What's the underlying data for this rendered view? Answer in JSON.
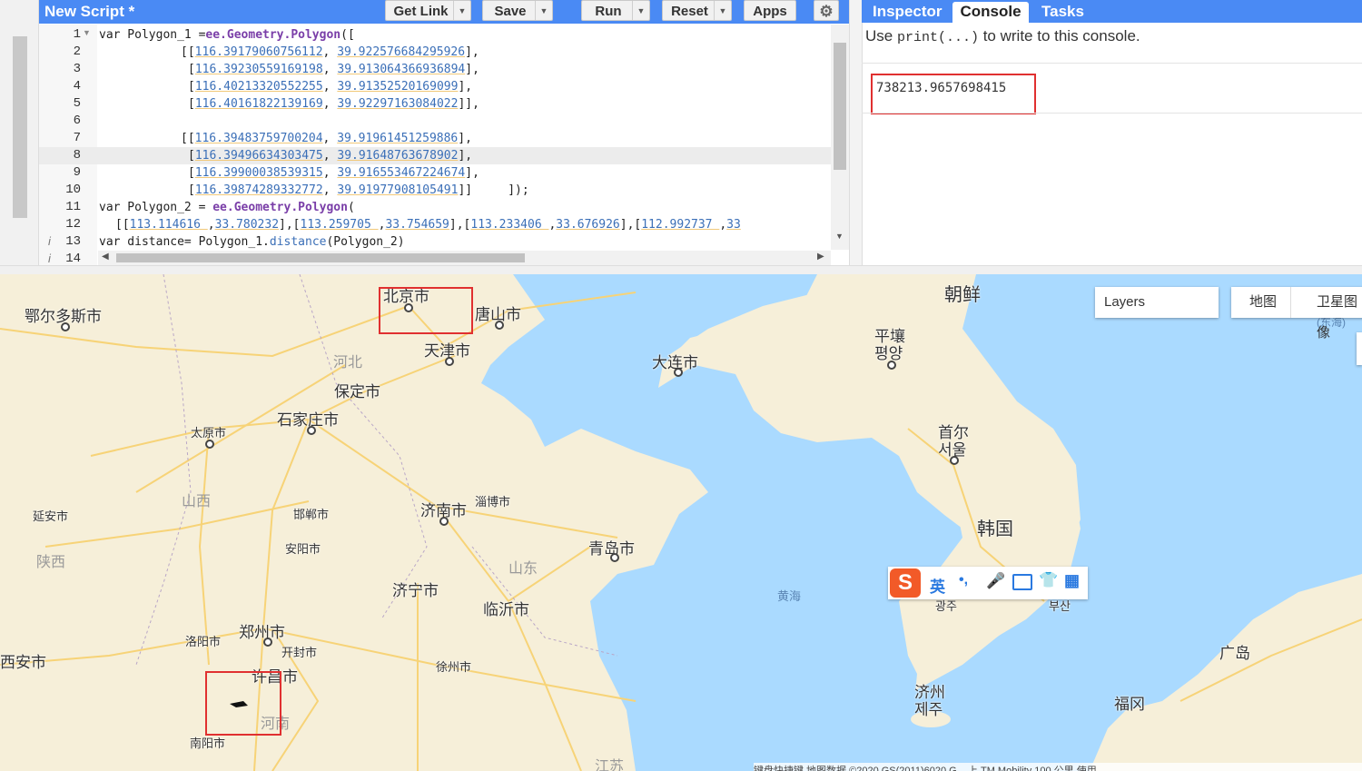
{
  "editor": {
    "title": "New Script *",
    "buttons": {
      "get_link": "Get Link",
      "save": "Save",
      "run": "Run",
      "reset": "Reset",
      "apps": "Apps"
    },
    "line_numbers": [
      "1",
      "2",
      "3",
      "4",
      "5",
      "6",
      "7",
      "8",
      "9",
      "10",
      "11",
      "12",
      "13",
      "14"
    ],
    "code": {
      "l1_kw": "var",
      "l1_a": " Polygon_1 =",
      "l1_ee": "ee.Geometry.Polygon",
      "l1_b": "([",
      "l2_a": "[[",
      "l2_n1": "116.39179060756112",
      "l2_c": ", ",
      "l2_n2": "39.922576684295926",
      "l2_e": "],",
      "l3_a": "[",
      "l3_n1": "116.39230559169198",
      "l3_n2": "39.913064366936894",
      "l3_e": "],",
      "l4_a": "[",
      "l4_n1": "116.40213320552255",
      "l4_n2": "39.91352520169099",
      "l4_e": "],",
      "l5_a": "[",
      "l5_n1": "116.40161822139169",
      "l5_n2": "39.92297163084022",
      "l5_e": "]],",
      "l7_a": "[[",
      "l7_n1": "116.39483759700204",
      "l7_n2": "39.91961451259886",
      "l7_e": "],",
      "l8_a": "[",
      "l8_n1": "116.39496634303475",
      "l8_n2": "39.91648763678902",
      "l8_e": "],",
      "l9_a": "[",
      "l9_n1": "116.39900038539315",
      "l9_n2": "39.916553467224674",
      "l9_e": "],",
      "l10_a": "[",
      "l10_n1": "116.39874289332772",
      "l10_n2": "39.91977908105491",
      "l10_e": "]]     ]);",
      "l11_kw": "var",
      "l11_a": " Polygon_2 = ",
      "l11_ee": "ee.Geometry.Polygon",
      "l11_b": "(",
      "l12_a": "[[",
      "l12_n1": "113.114616 ",
      "l12_c1": ",",
      "l12_n2": "33.780232",
      "l12_c2": "],[",
      "l12_n3": "113.259705 ",
      "l12_c3": ",",
      "l12_n4": "33.754659",
      "l12_c4": "],[",
      "l12_n5": "113.233406 ",
      "l12_c5": ",",
      "l12_n6": "33.676926",
      "l12_c6": "],[",
      "l12_n7": "112.992737 ",
      "l12_c7": ",",
      "l12_n8": "33",
      "l13_kw": "var",
      "l13_a": " distance= Polygon_1.",
      "l13_fn": "distance",
      "l13_b": "(Polygon_2)"
    }
  },
  "panel": {
    "tabs": [
      "Inspector",
      "Console",
      "Tasks"
    ],
    "hint_pre": "Use ",
    "hint_code": "print(...)",
    "hint_post": " to write to this console.",
    "output": "738213.9657698415"
  },
  "map": {
    "layers_label": "Layers",
    "map_type": [
      "地图",
      "卫星图像"
    ],
    "cities": [
      {
        "name": "北京市"
      },
      {
        "name": "唐山市"
      },
      {
        "name": "天津市"
      },
      {
        "name": "保定市"
      },
      {
        "name": "石家庄市"
      },
      {
        "name": "鄂尔多斯市"
      },
      {
        "name": "太原市"
      },
      {
        "name": "延安市"
      },
      {
        "name": "邯郸市"
      },
      {
        "name": "安阳市"
      },
      {
        "name": "济南市"
      },
      {
        "name": "淄博市"
      },
      {
        "name": "青岛市"
      },
      {
        "name": "济宁市"
      },
      {
        "name": "临沂市"
      },
      {
        "name": "郑州市"
      },
      {
        "name": "开封市"
      },
      {
        "name": "洛阳市"
      },
      {
        "name": "许昌市"
      },
      {
        "name": "西安市"
      },
      {
        "name": "南阳市"
      },
      {
        "name": "徐州市"
      },
      {
        "name": "大连市"
      },
      {
        "name": "朝鲜"
      },
      {
        "name": "平壤"
      },
      {
        "name": "평양"
      },
      {
        "name": "首尔"
      },
      {
        "name": "서울"
      },
      {
        "name": "韩国"
      },
      {
        "name": "광주"
      },
      {
        "name": "부산"
      },
      {
        "name": "济州"
      },
      {
        "name": "제주"
      },
      {
        "name": "广岛"
      },
      {
        "name": "福冈"
      }
    ],
    "provinces": [
      "河北",
      "山西",
      "陕西",
      "山东",
      "河南",
      "江苏",
      "黄海",
      "(东海)"
    ],
    "ime": {
      "lang": "英"
    },
    "footer": "键盘快捷键    地图数据 ©2020 GS(2011)6020 G...  上 TM  Mobility  100 公里      使用"
  },
  "colors": {
    "accent": "#4a8af4",
    "highlight": "#e03030",
    "sea": "#aadaff",
    "land": "#f6efd9",
    "road": "#f7d377"
  }
}
